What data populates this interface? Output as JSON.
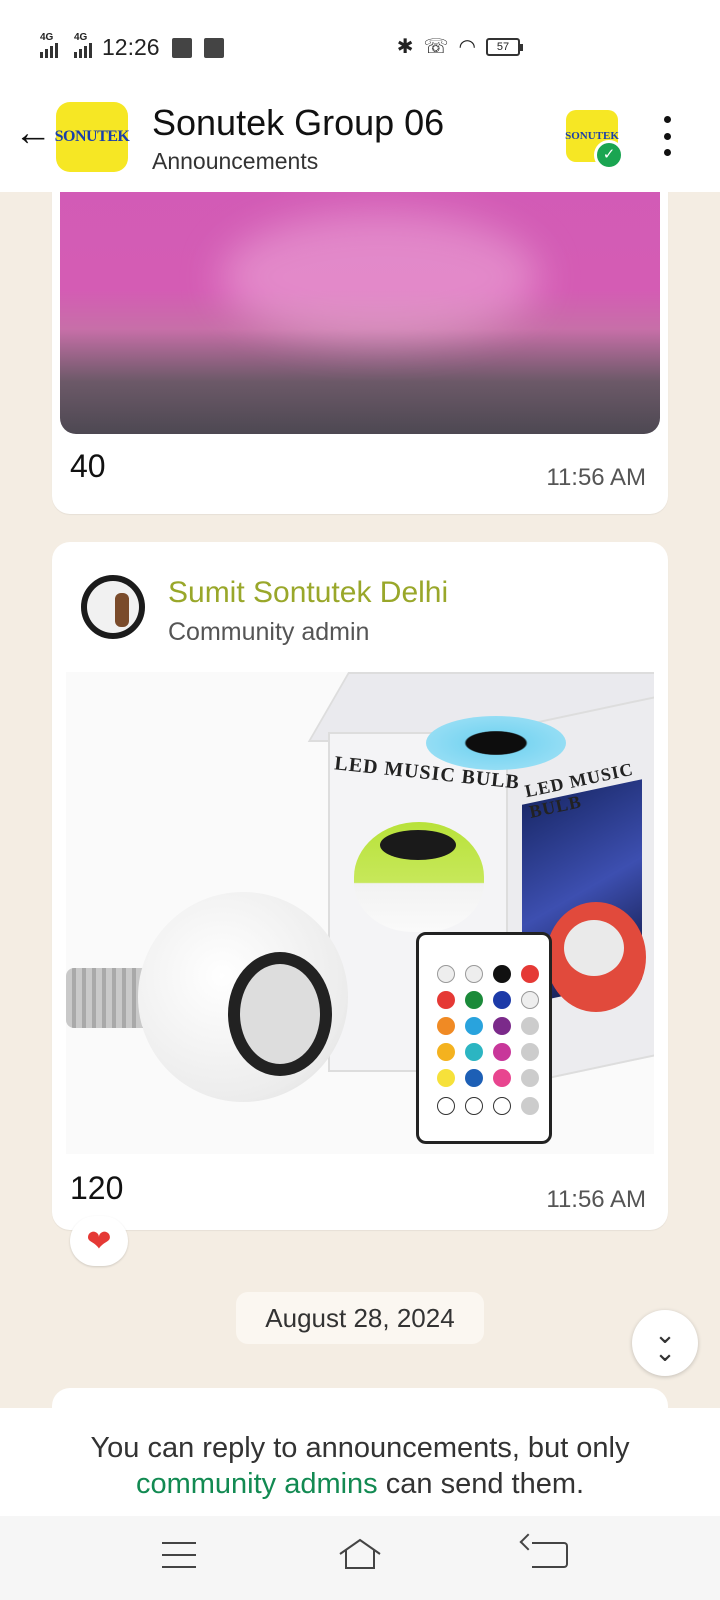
{
  "status_bar": {
    "time": "12:26",
    "network1": "4G",
    "network2": "4G",
    "battery": "57"
  },
  "header": {
    "back_icon": "arrow-left-icon",
    "group_logo_text": "SONUTEK",
    "title": "Sonutek Group 06",
    "subtitle": "Announcements",
    "community_logo_text": "SONUTEK",
    "menu_icon": "more-vertical-icon"
  },
  "messages": [
    {
      "caption": "40",
      "time": "11:56 AM"
    },
    {
      "sender": "Sumit Sontutek Delhi",
      "role": "Community admin",
      "product_label": "LED MUSIC BULB",
      "caption": "120",
      "time": "11:56 AM",
      "reaction": "❤"
    }
  ],
  "date_separator": "August 28, 2024",
  "scroll_button_icon": "double-chevron-down-icon",
  "notice": {
    "prefix": "You can reply to announcements, but only",
    "link": "community admins",
    "suffix": "can send them."
  },
  "colors": {
    "sender_name": "#99a72a",
    "link": "#128a52",
    "chat_background": "#f4ede3",
    "logo_yellow": "#f6e724"
  }
}
